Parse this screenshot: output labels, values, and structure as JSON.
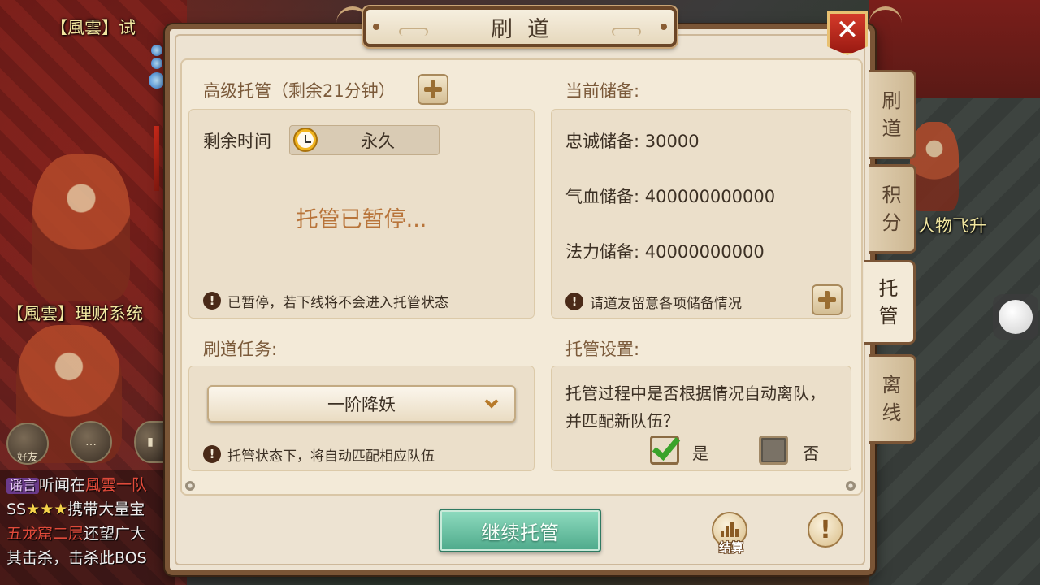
{
  "window": {
    "title": "刷道",
    "close_label": "✕"
  },
  "background": {
    "top_label": "【風雲】试",
    "finance_label": "【風雲】理财系统",
    "ascend_label": "人物飞升",
    "friends_label": "好友",
    "chat_lines": [
      {
        "tag": "谣言",
        "pre": "听闻在",
        "hl": "風雲一队",
        "post": ""
      },
      {
        "pre": "SS",
        "star": "★★★",
        "post": "携带大量宝"
      },
      {
        "hl": "五龙窟二层",
        "post": "还望广大"
      },
      {
        "pre": "其击杀，击杀此BOS"
      }
    ]
  },
  "left": {
    "managed_title": "高级托管（剩余21分钟）",
    "remaining_label": "剩余时间",
    "remaining_value": "永久",
    "status_text": "托管已暂停...",
    "pause_note": "已暂停，若下线将不会进入托管状态",
    "task_title": "刷道任务:",
    "task_selected": "一阶降妖",
    "task_note": "托管状态下，将自动匹配相应队伍"
  },
  "right": {
    "reserve_title": "当前储备:",
    "reserves": [
      {
        "label": "忠诚储备:",
        "value": "30000"
      },
      {
        "label": "气血储备:",
        "value": "400000000000"
      },
      {
        "label": "法力储备:",
        "value": "40000000000"
      }
    ],
    "reserve_note": "请道友留意各项储备情况",
    "settings_title": "托管设置:",
    "settings_question_line1": "托管过程中是否根据情况自动离队，",
    "settings_question_line2": "并匹配新队伍？",
    "yes_label": "是",
    "no_label": "否",
    "yes_checked": true
  },
  "footer": {
    "continue_label": "继续托管",
    "settle_label": "结算",
    "help_label": "!"
  },
  "side_tabs": [
    {
      "c1": "刷",
      "c2": "道"
    },
    {
      "c1": "积",
      "c2": "分"
    },
    {
      "c1": "托",
      "c2": "管"
    },
    {
      "c1": "离",
      "c2": "线"
    }
  ],
  "colors": {
    "accent_brown": "#7b5a3a",
    "status_orange": "#b8743a",
    "continue_green": "#4ea98a",
    "close_red": "#d43a2a"
  }
}
